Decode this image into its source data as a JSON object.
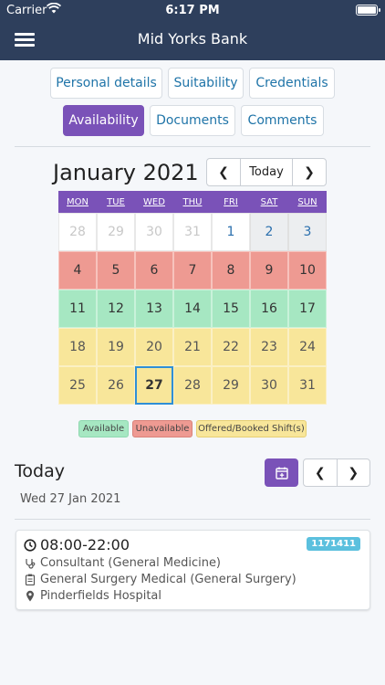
{
  "status": {
    "carrier": "Carrier",
    "time": "6:17 PM"
  },
  "nav": {
    "title": "Mid Yorks Bank"
  },
  "tabs": [
    {
      "label": "Personal details"
    },
    {
      "label": "Suitability"
    },
    {
      "label": "Credentials"
    },
    {
      "label": "Availability"
    },
    {
      "label": "Documents"
    },
    {
      "label": "Comments"
    }
  ],
  "calendar": {
    "month": "January 2021",
    "today_label": "Today",
    "weekdays": [
      "MON",
      "TUE",
      "WED",
      "THU",
      "FRI",
      "SAT",
      "SUN"
    ],
    "days": [
      {
        "n": "28",
        "s": "other"
      },
      {
        "n": "29",
        "s": "other"
      },
      {
        "n": "30",
        "s": "other"
      },
      {
        "n": "31",
        "s": "other"
      },
      {
        "n": "1",
        "s": "plain"
      },
      {
        "n": "2",
        "s": "weekend"
      },
      {
        "n": "3",
        "s": "weekend"
      },
      {
        "n": "4",
        "s": "unavail"
      },
      {
        "n": "5",
        "s": "unavail"
      },
      {
        "n": "6",
        "s": "unavail"
      },
      {
        "n": "7",
        "s": "unavail"
      },
      {
        "n": "8",
        "s": "unavail"
      },
      {
        "n": "9",
        "s": "unavail"
      },
      {
        "n": "10",
        "s": "unavail"
      },
      {
        "n": "11",
        "s": "avail"
      },
      {
        "n": "12",
        "s": "avail"
      },
      {
        "n": "13",
        "s": "avail"
      },
      {
        "n": "14",
        "s": "avail"
      },
      {
        "n": "15",
        "s": "avail"
      },
      {
        "n": "16",
        "s": "avail"
      },
      {
        "n": "17",
        "s": "avail"
      },
      {
        "n": "18",
        "s": "offered"
      },
      {
        "n": "19",
        "s": "offered"
      },
      {
        "n": "20",
        "s": "offered"
      },
      {
        "n": "21",
        "s": "offered"
      },
      {
        "n": "22",
        "s": "offered"
      },
      {
        "n": "23",
        "s": "offered"
      },
      {
        "n": "24",
        "s": "offered"
      },
      {
        "n": "25",
        "s": "offered"
      },
      {
        "n": "26",
        "s": "offered"
      },
      {
        "n": "27",
        "s": "offered selected"
      },
      {
        "n": "28",
        "s": "offered"
      },
      {
        "n": "29",
        "s": "offered"
      },
      {
        "n": "30",
        "s": "offered"
      },
      {
        "n": "31",
        "s": "offered"
      }
    ]
  },
  "legend": {
    "available": "Available",
    "unavailable": "Unavailable",
    "offered": "Offered/Booked Shift(s)"
  },
  "colors": {
    "nav_bg": "#2e3f5c",
    "accent": "#7a52b8",
    "available": "#a6e7c2",
    "unavailable": "#ee9a92",
    "offered": "#f8e69a",
    "badge": "#5bc0de"
  },
  "today": {
    "title": "Today",
    "date": "Wed 27 Jan 2021"
  },
  "shift": {
    "time": "08:00-22:00",
    "role": "Consultant (General Medicine)",
    "ward": "General Surgery Medical (General Surgery)",
    "location": "Pinderfields Hospital",
    "ref": "1171411"
  }
}
